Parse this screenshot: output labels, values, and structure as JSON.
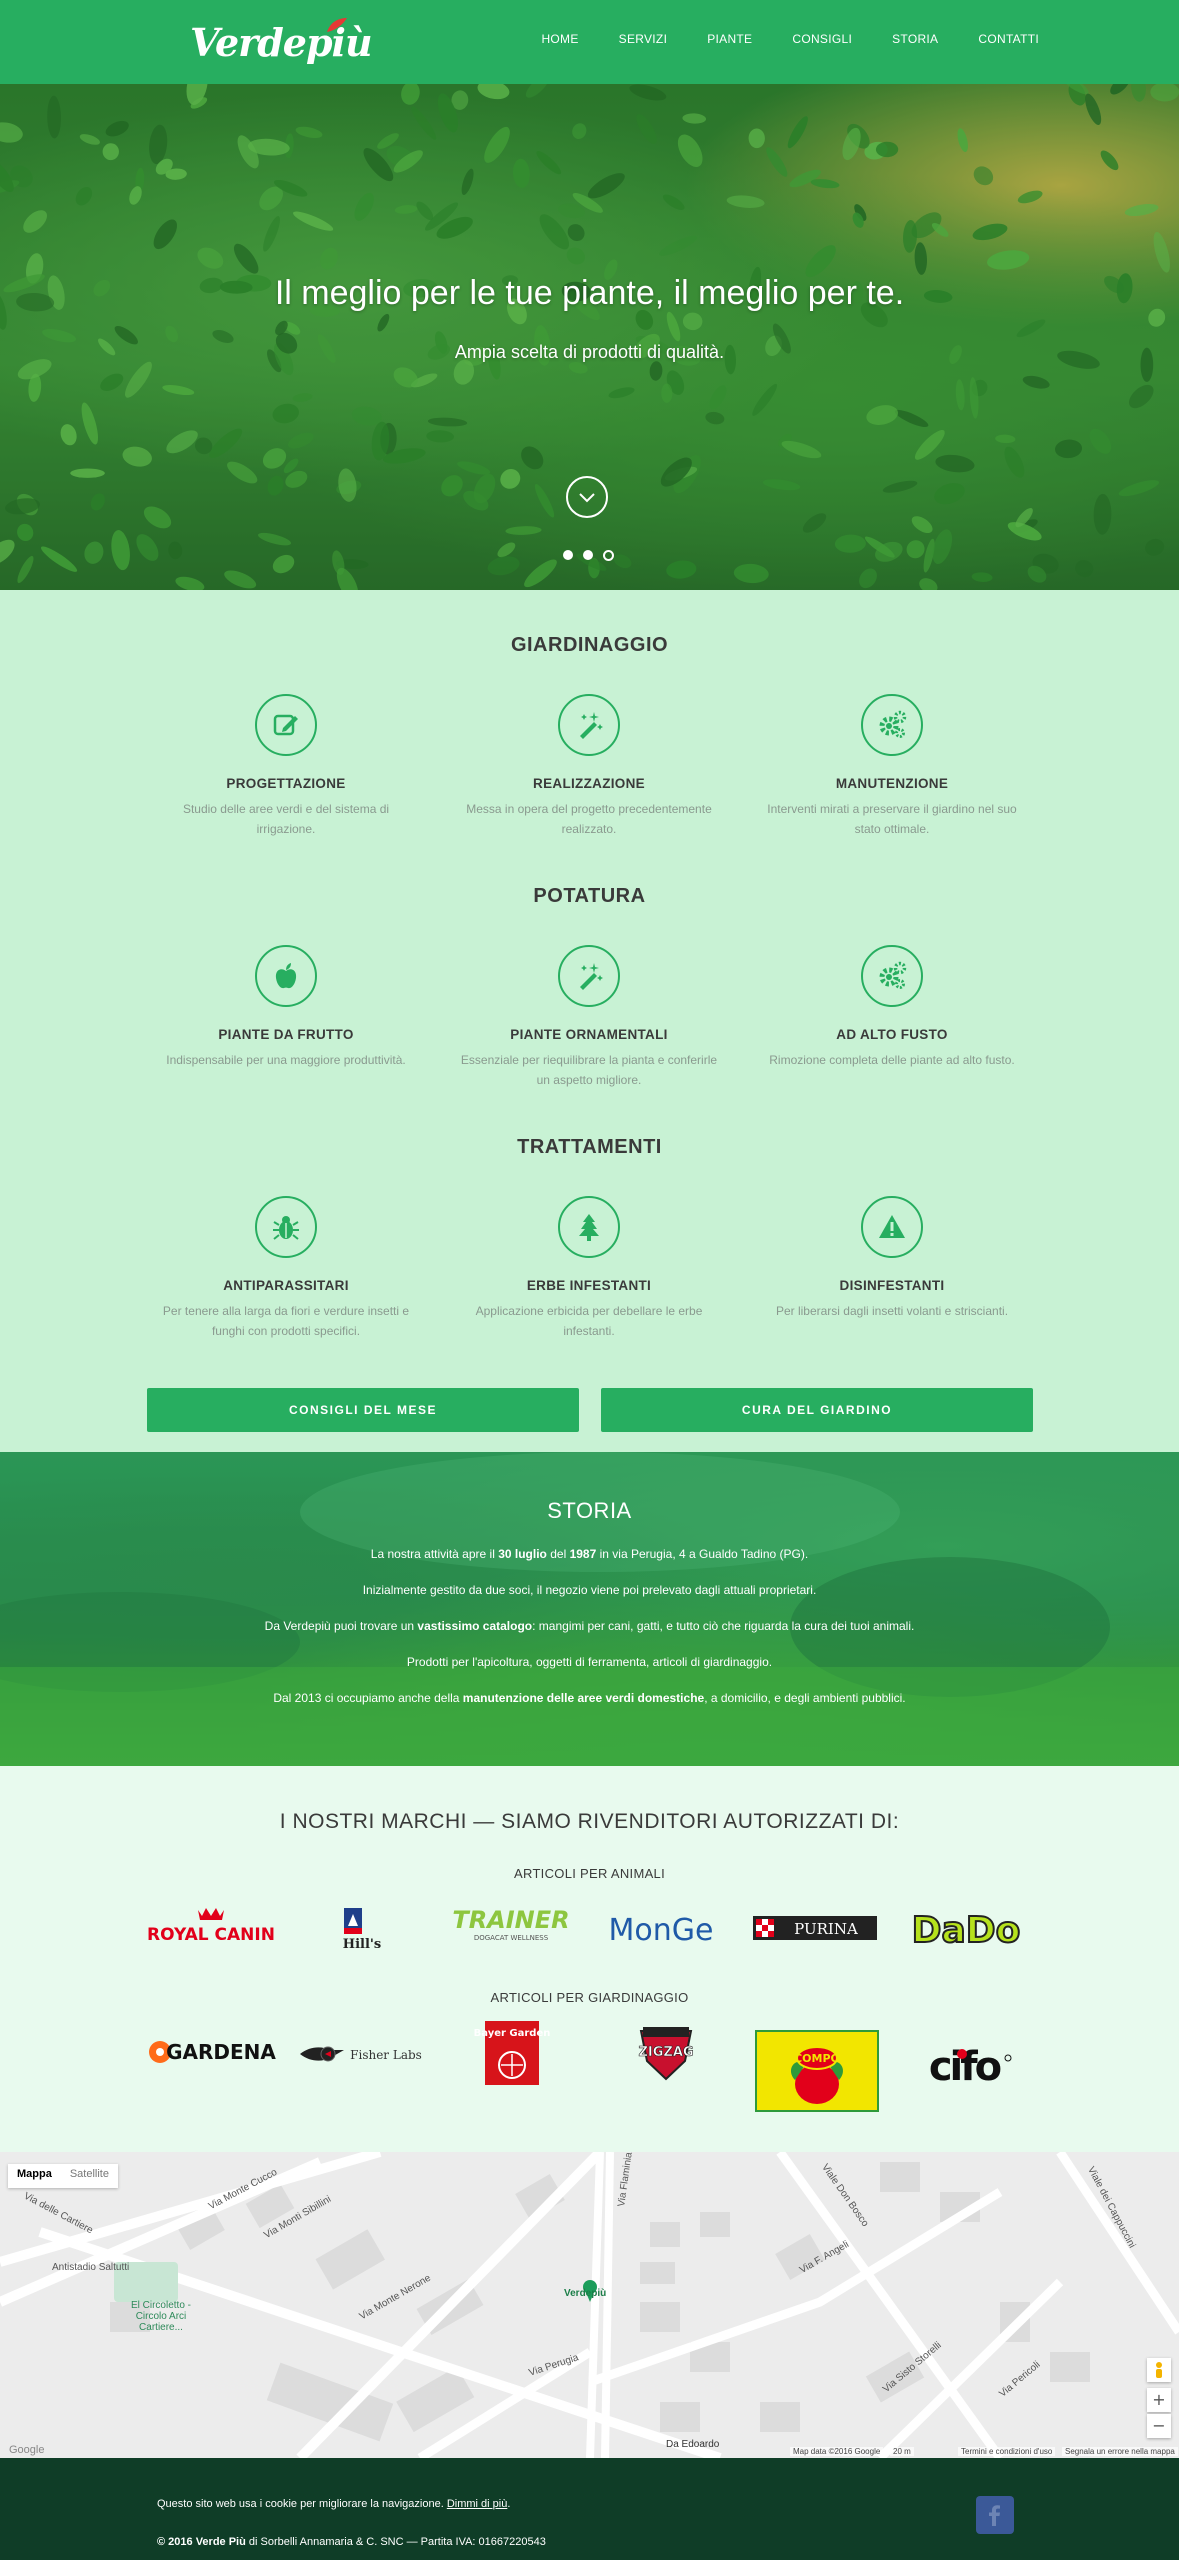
{
  "brand": {
    "logo_text": "Verdepiù"
  },
  "nav": {
    "items": [
      "HOME",
      "SERVIZI",
      "PIANTE",
      "CONSIGLI",
      "STORIA",
      "CONTATTI"
    ]
  },
  "hero": {
    "title": "Il meglio per le tue piante, il meglio per te.",
    "subtitle": "Ampia scelta di prodotti di qualità.",
    "slides": 3,
    "active_slide": 3
  },
  "services": {
    "giardinaggio": {
      "title": "GIARDINAGGIO",
      "items": [
        {
          "icon": "edit-icon",
          "name": "PROGETTAZIONE",
          "desc": "Studio delle aree verdi e del sistema di irrigazione."
        },
        {
          "icon": "magic-wand-icon",
          "name": "REALIZZAZIONE",
          "desc": "Messa in opera del progetto precedentemente realizzato."
        },
        {
          "icon": "gears-icon",
          "name": "MANUTENZIONE",
          "desc": "Interventi mirati a preservare il giardino nel suo stato ottimale."
        }
      ]
    },
    "potatura": {
      "title": "POTATURA",
      "items": [
        {
          "icon": "apple-icon",
          "name": "PIANTE DA FRUTTO",
          "desc": "Indispensabile per una maggiore produttività."
        },
        {
          "icon": "magic-wand-icon",
          "name": "PIANTE ORNAMENTALI",
          "desc": "Essenziale per riequilibrare la pianta e conferirle un aspetto migliore."
        },
        {
          "icon": "gears-icon",
          "name": "AD ALTO FUSTO",
          "desc": "Rimozione completa delle piante ad alto fusto."
        }
      ]
    },
    "trattamenti": {
      "title": "TRATTAMENTI",
      "items": [
        {
          "icon": "bug-icon",
          "name": "ANTIPARASSITARI",
          "desc": "Per tenere alla larga da fiori e verdure insetti e funghi con prodotti specifici."
        },
        {
          "icon": "tree-icon",
          "name": "ERBE INFESTANTI",
          "desc": "Applicazione erbicida per debellare le erbe infestanti."
        },
        {
          "icon": "warning-icon",
          "name": "DISINFESTANTI",
          "desc": "Per liberarsi dagli insetti volanti e striscianti."
        }
      ]
    },
    "buttons": {
      "consigli": "CONSIGLI DEL MESE",
      "cura": "CURA DEL GIARDINO"
    }
  },
  "storia": {
    "title": "STORIA",
    "p1": {
      "a": "La nostra attività apre il ",
      "b1": "30 luglio",
      "c": " del ",
      "b2": "1987",
      "d": " in via Perugia, 4 a Gualdo Tadino (PG)."
    },
    "p2": "Inizialmente gestito da due soci, il negozio viene poi prelevato dagli attuali proprietari.",
    "p3": {
      "a": "Da Verdepiù puoi trovare un ",
      "b": "vastissimo catalogo",
      "c": ": mangimi per cani, gatti, e tutto ciò che riguarda la cura dei tuoi animali."
    },
    "p4": "Prodotti per l'apicoltura, oggetti di ferramenta, articoli di giardinaggio.",
    "p5": {
      "a": "Dal 2013 ci occupiamo anche della ",
      "b": "manutenzione delle aree verdi domestiche",
      "c": ", a domicilio, e degli ambienti pubblici."
    }
  },
  "brands": {
    "title": "I NOSTRI MARCHI — SIAMO RIVENDITORI AUTORIZZATI DI:",
    "animali_title": "ARTICOLI PER ANIMALI",
    "animali": [
      "ROYAL CANIN",
      "Hill's",
      "TRAINER",
      "DOGACAT WELLNESS",
      "MonGe",
      "PURINA",
      "DaDo"
    ],
    "giardinaggio_title": "ARTICOLI PER GIARDINAGGIO",
    "giardinaggio": [
      "GARDENA",
      "Fisher Labs",
      "Bayer Garden",
      "ZIGZAG",
      "COMPO",
      "cifo"
    ]
  },
  "map": {
    "toggle_map": "Mappa",
    "toggle_sat": "Satellite",
    "marker": "Verdepiù",
    "labels": [
      "Antistadio Saltutti",
      "El Circoletto - Circolo Arci Cartiere...",
      "Da Edoardo",
      "Via delle Cartiere",
      "Via Monte Cucco",
      "Via Monti Sibillini",
      "Via Monte Nerone",
      "Via Perugia",
      "Via Flaminia",
      "Viale Don Bosco",
      "Via F. Angeli",
      "Viale dei Cappuccini",
      "Via Sisto Storelli",
      "Via Pericoli"
    ],
    "attribution": "Map data ©2016 Google",
    "scale": "20 m",
    "terms": "Termini e condizioni d'uso",
    "report": "Segnala un errore nella mappa",
    "google": "Google"
  },
  "footer": {
    "cookie_text": "Questo sito web usa i cookie per migliorare la navigazione. ",
    "cookie_link": "Dimmi di più",
    "cookie_end": ".",
    "copyright_bold": "© 2016 Verde Più",
    "copyright_rest": " di Sorbelli Annamaria & C. SNC — Partita IVA: 01667220543"
  },
  "colors": {
    "primary": "#27ae60",
    "services_bg": "#c8f2d4",
    "brands_bg": "#e8faee",
    "footer_bg": "#0f3d27"
  }
}
